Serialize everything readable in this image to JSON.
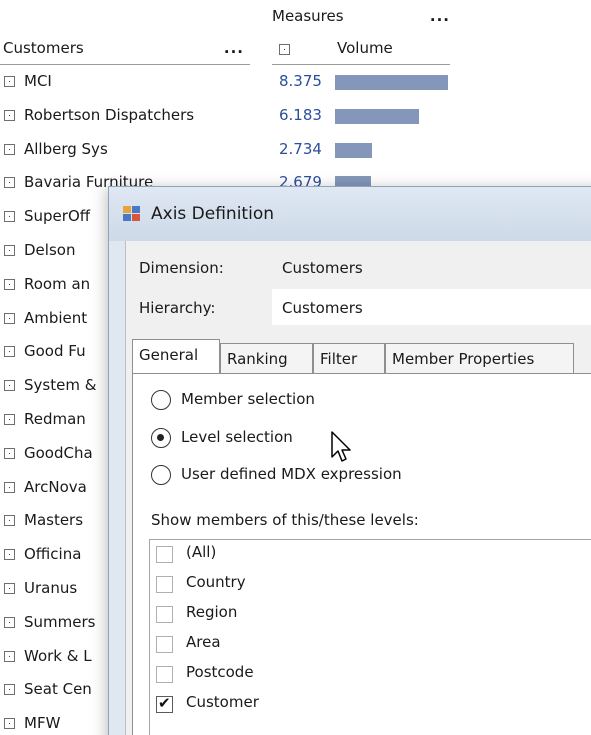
{
  "pivot": {
    "measures_label": "Measures",
    "measures_menu": "...",
    "customers_label": "Customers",
    "customers_menu": "...",
    "volume_label": "Volume",
    "bar_color": "#8497bb",
    "rows": [
      {
        "name": "MCI",
        "value": "8.375",
        "bar_fraction": 1.0
      },
      {
        "name": "Robertson Dispatchers",
        "value": "6.183",
        "bar_fraction": 0.74
      },
      {
        "name": "Allberg Sys",
        "value": "2.734",
        "bar_fraction": 0.33
      },
      {
        "name": "Bavaria Furniture",
        "value": "2.679",
        "bar_fraction": 0.32
      },
      {
        "name": "SuperOff",
        "value": "",
        "bar_fraction": 0
      },
      {
        "name": "Delson",
        "value": "",
        "bar_fraction": 0
      },
      {
        "name": "Room an",
        "value": "",
        "bar_fraction": 0
      },
      {
        "name": "Ambient",
        "value": "",
        "bar_fraction": 0
      },
      {
        "name": "Good Fu",
        "value": "",
        "bar_fraction": 0
      },
      {
        "name": "System &",
        "value": "",
        "bar_fraction": 0
      },
      {
        "name": "Redman",
        "value": "",
        "bar_fraction": 0
      },
      {
        "name": "GoodCha",
        "value": "",
        "bar_fraction": 0
      },
      {
        "name": "ArcNova",
        "value": "",
        "bar_fraction": 0
      },
      {
        "name": "Masters",
        "value": "",
        "bar_fraction": 0
      },
      {
        "name": "Officina",
        "value": "",
        "bar_fraction": 0
      },
      {
        "name": "Uranus",
        "value": "",
        "bar_fraction": 0
      },
      {
        "name": "Summers",
        "value": "",
        "bar_fraction": 0
      },
      {
        "name": "Work & L",
        "value": "",
        "bar_fraction": 0
      },
      {
        "name": "Seat Cen",
        "value": "",
        "bar_fraction": 0
      },
      {
        "name": "MFW",
        "value": "",
        "bar_fraction": 0
      }
    ]
  },
  "dialog": {
    "title": "Axis Definition",
    "dimension_label": "Dimension:",
    "dimension_value": "Customers",
    "hierarchy_label": "Hierarchy:",
    "hierarchy_value": "Customers",
    "tabs": [
      {
        "label": "General",
        "active": true
      },
      {
        "label": "Ranking",
        "active": false
      },
      {
        "label": "Filter",
        "active": false
      },
      {
        "label": "Member Properties",
        "active": false
      }
    ],
    "radios": [
      {
        "label": "Member selection",
        "selected": false
      },
      {
        "label": "Level selection",
        "selected": true
      },
      {
        "label": "User defined MDX expression",
        "selected": false
      }
    ],
    "levels_label": "Show members of this/these levels:",
    "levels": [
      {
        "label": "(All)",
        "checked": false
      },
      {
        "label": "Country",
        "checked": false
      },
      {
        "label": "Region",
        "checked": false
      },
      {
        "label": "Area",
        "checked": false
      },
      {
        "label": "Postcode",
        "checked": false
      },
      {
        "label": "Customer",
        "checked": true
      }
    ]
  }
}
